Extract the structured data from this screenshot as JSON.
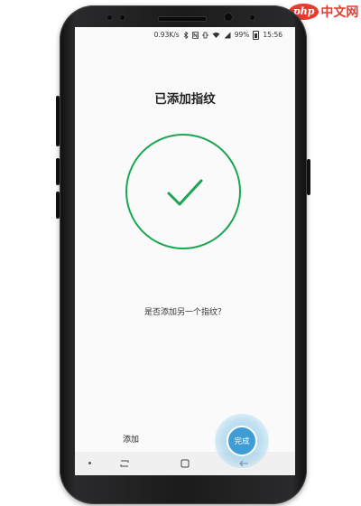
{
  "watermark": {
    "logo_badge": "php",
    "logo_text": "中文网"
  },
  "status_bar": {
    "speed": "0.93K/s",
    "battery": "99%",
    "time": "15:56",
    "icons": [
      "bluetooth-icon",
      "nfc-icon",
      "vibrate-icon",
      "wifi-icon",
      "signal-icon",
      "battery-icon"
    ]
  },
  "screen": {
    "title": "已添加指纹",
    "question": "是否添加另一个指纹？",
    "success_color": "#1aa650"
  },
  "actions": {
    "add_label": "添加",
    "done_label": "完成"
  },
  "navbar": {
    "icons": [
      "recent-apps-icon",
      "home-icon",
      "back-icon"
    ]
  }
}
